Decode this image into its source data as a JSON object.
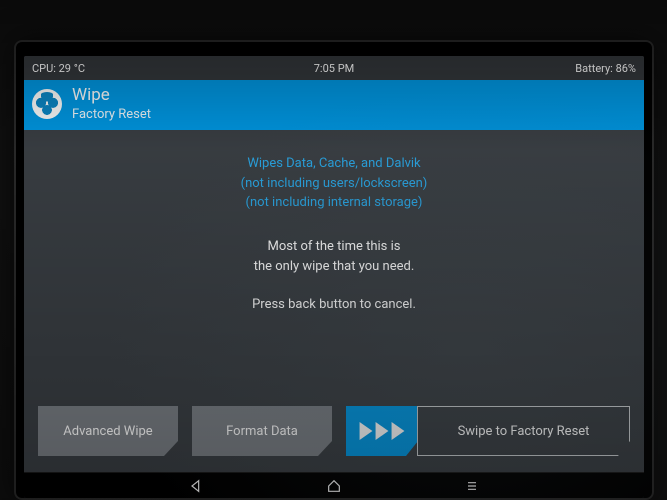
{
  "status": {
    "cpu": "CPU: 29 °C",
    "time": "7:05 PM",
    "battery": "Battery: 86%"
  },
  "header": {
    "title": "Wipe",
    "subtitle": "Factory Reset"
  },
  "info_highlight": {
    "line1": "Wipes Data, Cache, and Dalvik",
    "line2": "(not including users/lockscreen)",
    "line3": "(not including internal storage)"
  },
  "info_plain": {
    "line1": "Most of the time this is",
    "line2": "the only wipe that you need.",
    "line3": "Press back button to cancel."
  },
  "buttons": {
    "advanced": "Advanced Wipe",
    "format": "Format Data"
  },
  "slider": {
    "label": "Swipe to Factory Reset"
  },
  "colors": {
    "accent": "#0099e5",
    "surface": "#3a3f44",
    "button": "#7a7f85"
  }
}
